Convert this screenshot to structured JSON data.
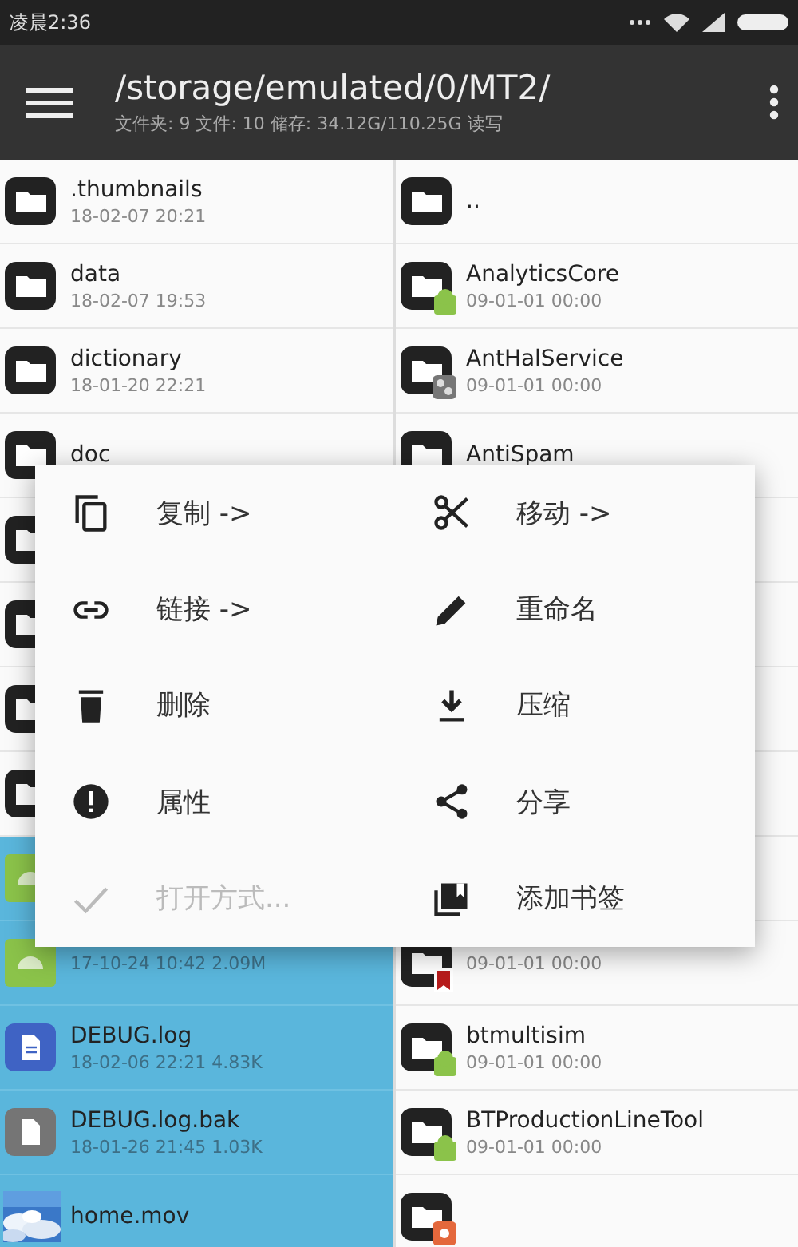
{
  "status_bar": {
    "time": "凌晨2:36"
  },
  "app_bar": {
    "title": "/storage/emulated/0/MT2/",
    "subtitle": "文件夹: 9  文件: 10  储存: 34.12G/110.25G  读写"
  },
  "left_pane": {
    "rows": [
      {
        "kind": "folder",
        "name": ".thumbnails",
        "meta": "18-02-07 20:21",
        "selected": false
      },
      {
        "kind": "folder",
        "name": "data",
        "meta": "18-02-07 19:53",
        "selected": false
      },
      {
        "kind": "folder",
        "name": "dictionary",
        "meta": "18-01-20 22:21",
        "selected": false
      },
      {
        "kind": "folder",
        "name": "doc",
        "selected": false
      },
      {
        "kind": "folder_edge",
        "selected": false
      },
      {
        "kind": "folder_edge",
        "selected": false
      },
      {
        "kind": "folder_edge",
        "selected": false
      },
      {
        "kind": "folder_edge",
        "selected": false
      },
      {
        "kind": "apk_edge",
        "selected": true
      },
      {
        "kind": "apk",
        "meta": "17-10-24 10:42  2.09M",
        "selected": true
      },
      {
        "kind": "log",
        "name": "DEBUG.log",
        "meta": "18-02-06 22:21  4.83K",
        "selected": true
      },
      {
        "kind": "file",
        "name": "DEBUG.log.bak",
        "meta": "18-01-26 21:45  1.03K",
        "selected": true
      },
      {
        "kind": "video",
        "name": "home.mov",
        "selected": true
      }
    ]
  },
  "right_pane": {
    "rows": [
      {
        "kind": "folder",
        "name": "..",
        "selected": false
      },
      {
        "kind": "android_folder",
        "name": "AnalyticsCore",
        "meta": "09-01-01 00:00",
        "selected": false
      },
      {
        "kind": "share_folder",
        "name": "AntHalService",
        "meta": "09-01-01 00:00",
        "selected": false
      },
      {
        "kind": "folder",
        "name": "AntiSpam",
        "selected": false
      },
      {
        "kind": "hidden",
        "selected": false
      },
      {
        "kind": "hidden",
        "selected": false
      },
      {
        "kind": "hidden",
        "selected": false
      },
      {
        "kind": "hidden",
        "selected": false
      },
      {
        "kind": "hidden",
        "selected": false
      },
      {
        "kind": "bookmark_folder",
        "meta": "09-01-01 00:00",
        "selected": false
      },
      {
        "kind": "android_folder",
        "name": "btmultisim",
        "meta": "09-01-01 00:00",
        "selected": false
      },
      {
        "kind": "android_folder",
        "name": "BTProductionLineTool",
        "meta": "09-01-01 00:00",
        "selected": false
      },
      {
        "kind": "app_folder",
        "selected": false
      }
    ]
  },
  "context_menu": {
    "items": [
      {
        "kind": "copy",
        "label": "复制 ->",
        "disabled": false
      },
      {
        "kind": "cut",
        "label": "移动 ->",
        "disabled": false
      },
      {
        "kind": "link",
        "label": "链接 ->",
        "disabled": false
      },
      {
        "kind": "edit",
        "label": "重命名",
        "disabled": false
      },
      {
        "kind": "delete",
        "label": "删除",
        "disabled": false
      },
      {
        "kind": "compress",
        "label": "压缩",
        "disabled": false
      },
      {
        "kind": "info",
        "label": "属性",
        "disabled": false
      },
      {
        "kind": "share",
        "label": "分享",
        "disabled": false
      },
      {
        "kind": "check",
        "label": "打开方式...",
        "disabled": true
      },
      {
        "kind": "bookmark",
        "label": "添加书签",
        "disabled": false
      }
    ]
  }
}
